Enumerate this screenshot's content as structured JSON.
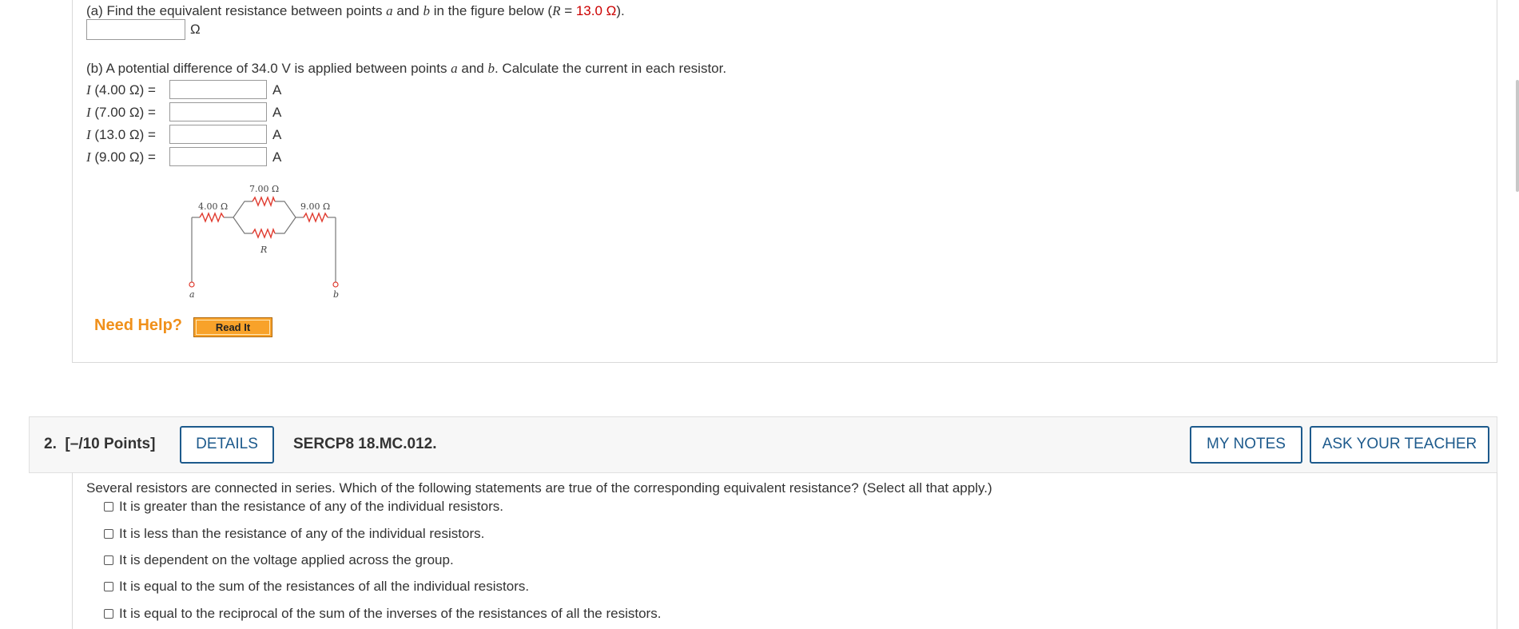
{
  "q1": {
    "part_a": {
      "text_before": "(a) Find the equivalent resistance between points ",
      "a": "a",
      "and": " and ",
      "b": "b",
      "text_after": " in the figure below (",
      "R": "R",
      "eq": " = ",
      "value": "13.0 Ω",
      "close": ").",
      "unit": "Ω"
    },
    "part_b": {
      "text1": "(b) A potential difference of 34.0 V is applied between points ",
      "a": "a",
      "and": " and ",
      "b": "b",
      "text2": ". Calculate the current in each resistor.",
      "rows": [
        {
          "I": "I",
          "label": " (4.00 Ω) =",
          "unit": "A"
        },
        {
          "I": "I",
          "label": " (7.00 Ω) =",
          "unit": "A"
        },
        {
          "I": "I",
          "label": " (13.0 Ω) =",
          "unit": "A"
        },
        {
          "I": "I",
          "label": " (9.00 Ω) =",
          "unit": "A"
        }
      ]
    },
    "figure": {
      "r1": "4.00 Ω",
      "r2": "7.00 Ω",
      "r3": "9.00 Ω",
      "r4": "R",
      "pt_a": "a",
      "pt_b": "b"
    },
    "help": {
      "label": "Need Help?",
      "read_it": "Read It"
    }
  },
  "q2": {
    "number": "2.",
    "points": "[–/10 Points]",
    "details": "DETAILS",
    "code": "SERCP8 18.MC.012.",
    "my_notes": "MY NOTES",
    "ask_teacher": "ASK YOUR TEACHER",
    "question": "Several resistors are connected in series. Which of the following statements are true of the corresponding equivalent resistance? (Select all that apply.)",
    "options": [
      "It is greater than the resistance of any of the individual resistors.",
      "It is less than the resistance of any of the individual resistors.",
      "It is dependent on the voltage applied across the group.",
      "It is equal to the sum of the resistances of all the individual resistors.",
      "It is equal to the reciprocal of the sum of the inverses of the resistances of all the resistors."
    ]
  },
  "colors": {
    "accent_red": "#cc0000",
    "help_orange": "#f0901a",
    "button_blue": "#1d5a8c",
    "resistor_red": "#e03a2e"
  }
}
